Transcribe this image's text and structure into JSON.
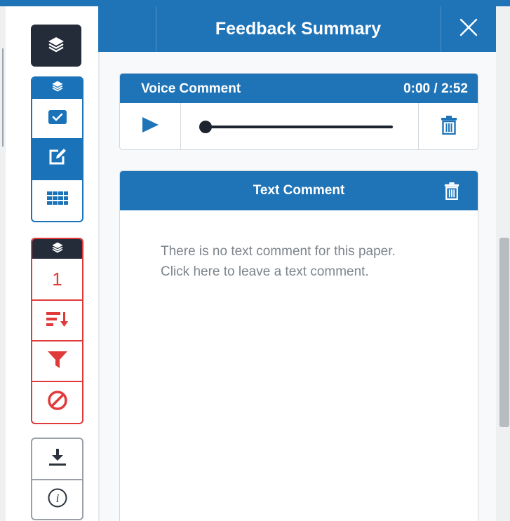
{
  "panel": {
    "title": "Feedback Summary",
    "close_icon": "close-icon"
  },
  "voice_comment": {
    "title": "Voice Comment",
    "time": "0:00 / 2:52",
    "progress": 0.0,
    "play_icon": "play-icon",
    "delete_icon": "trash-icon"
  },
  "text_comment": {
    "title": "Text Comment",
    "empty_message": "There is no text comment for this paper. Click here to leave a text comment.",
    "delete_icon": "trash-icon"
  },
  "sidebar": {
    "top_button_icon": "layers-icon",
    "group_blue": {
      "header_icon": "layers-icon",
      "items": [
        {
          "icon": "checkmark-icon"
        },
        {
          "icon": "edit-icon",
          "active": true
        },
        {
          "icon": "grid-icon"
        }
      ]
    },
    "group_red": {
      "header_icon": "layers-icon",
      "items": [
        {
          "icon": "count",
          "label": "1"
        },
        {
          "icon": "sort-icon"
        },
        {
          "icon": "filter-icon"
        },
        {
          "icon": "ban-icon"
        }
      ]
    },
    "group_grey": {
      "items": [
        {
          "icon": "download-icon"
        },
        {
          "icon": "info-icon"
        }
      ]
    }
  },
  "colors": {
    "primary": "#1f74b8",
    "dark": "#242c3a",
    "danger": "#e03a3a",
    "muted_text": "#7d848b"
  }
}
